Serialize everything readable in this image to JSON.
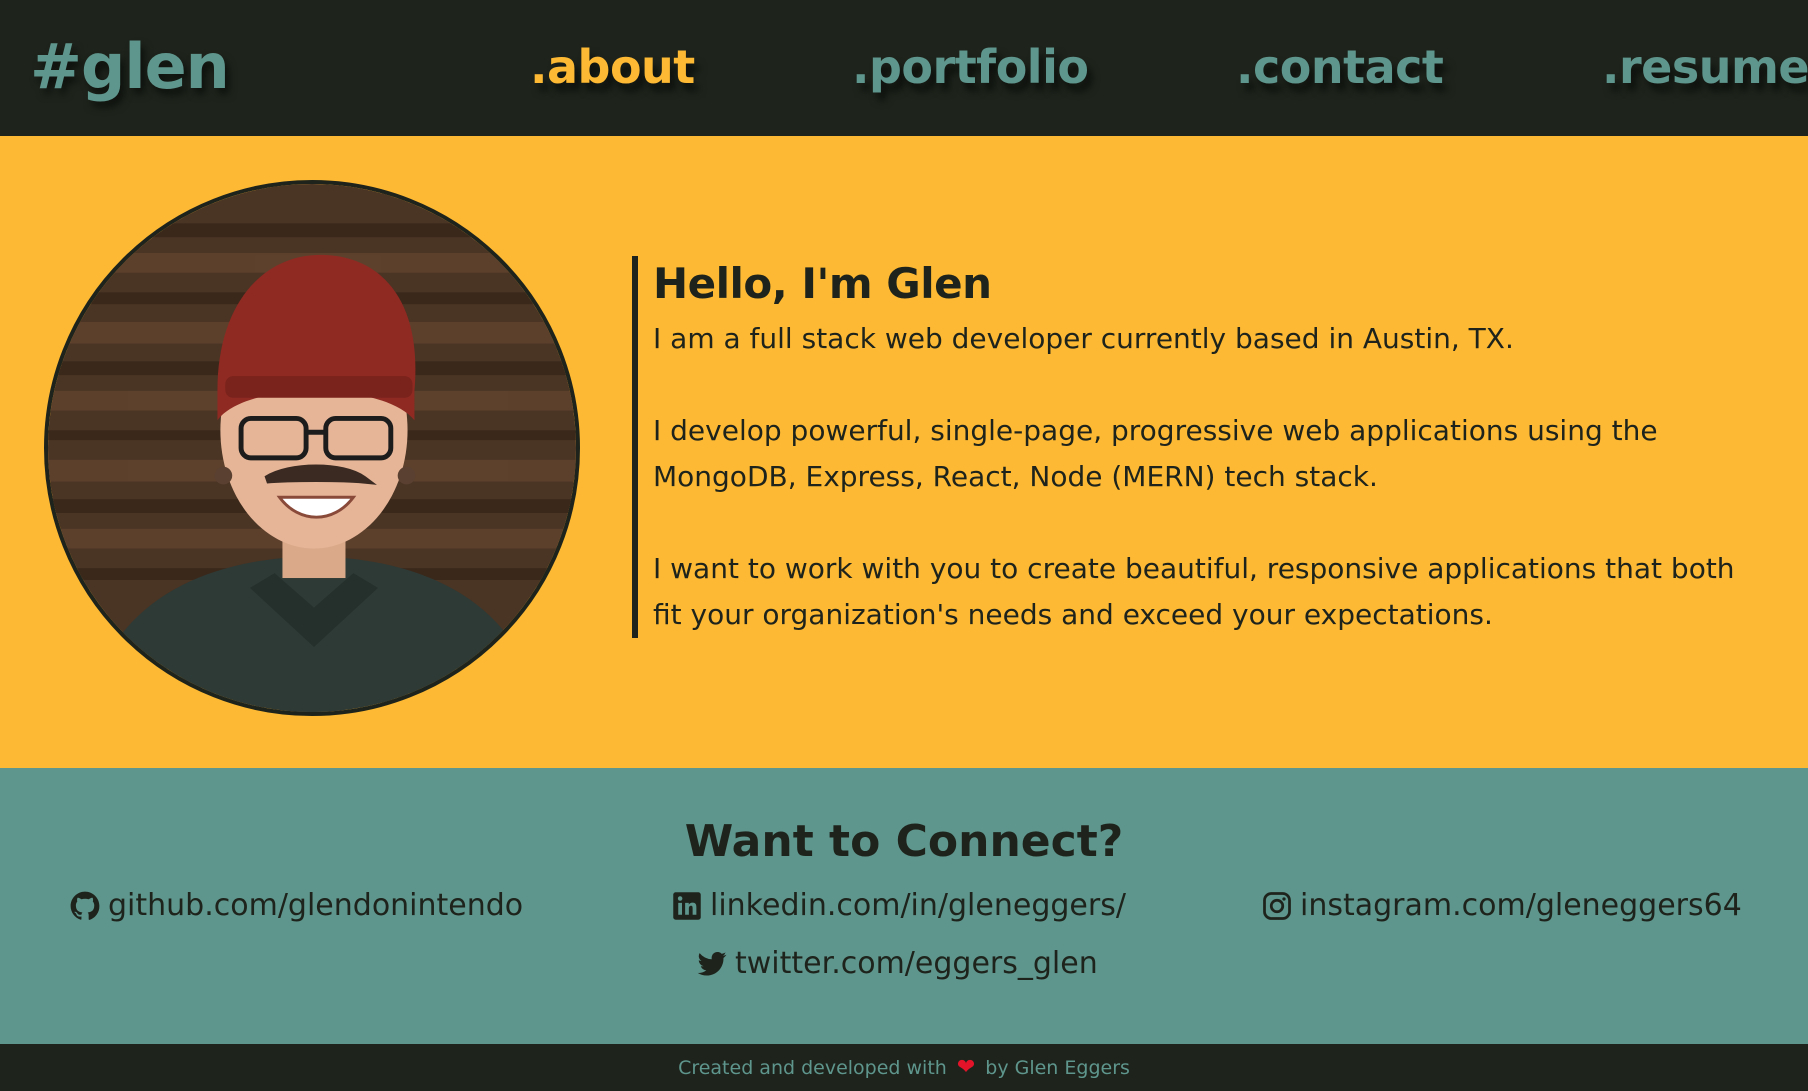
{
  "nav": {
    "brand": "#glen",
    "items": [
      {
        "label": ".about",
        "active": true
      },
      {
        "label": ".portfolio",
        "active": false
      },
      {
        "label": ".contact",
        "active": false
      },
      {
        "label": ".resume",
        "active": false
      }
    ]
  },
  "about": {
    "heading": "Hello, I'm Glen",
    "paragraphs": [
      "I am a full stack web developer currently based in Austin, TX.",
      "I develop powerful, single-page, progressive web applications using the MongoDB, Express, React, Node (MERN) tech stack.",
      "I want to work with you to create beautiful, responsive applications that both fit your organization's needs and exceed your expectations."
    ]
  },
  "connect": {
    "heading": "Want to Connect?",
    "links": {
      "github": {
        "label": "github.com/glendonintendo",
        "icon": "github-icon"
      },
      "linkedin": {
        "label": "linkedin.com/in/gleneggers/",
        "icon": "linkedin-icon"
      },
      "instagram": {
        "label": "instagram.com/gleneggers64",
        "icon": "instagram-icon"
      },
      "twitter": {
        "label": "twitter.com/eggers_glen",
        "icon": "twitter-icon"
      }
    }
  },
  "footer": {
    "prefix": "Created and developed with",
    "heart": "❤",
    "suffix": "by Glen Eggers"
  },
  "colors": {
    "dark": "#1e241c",
    "accent": "#fdb933",
    "teal": "#5e958c",
    "heart": "#e3132a"
  }
}
